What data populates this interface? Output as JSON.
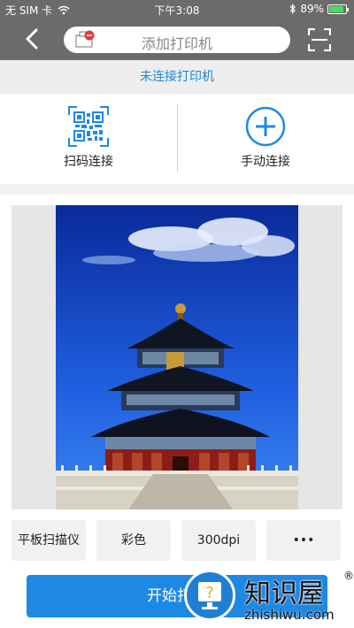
{
  "status_bar": {
    "carrier": "无 SIM 卡",
    "time": "下午3:08",
    "battery": "89%"
  },
  "nav": {
    "title": "添加打印机"
  },
  "banner": {
    "text": "未连接打印机"
  },
  "connect": {
    "scan_label": "扫码连接",
    "manual_label": "手动连接"
  },
  "options": [
    {
      "label": "平板扫描仪"
    },
    {
      "label": "彩色"
    },
    {
      "label": "300dpi"
    },
    {
      "label": "•••"
    }
  ],
  "start_button": {
    "label": "开始打印"
  },
  "watermark": {
    "brand": "知识屋",
    "url": "zhishiwu.com",
    "reg": "®"
  },
  "icons": {
    "back": "back-chevron-icon",
    "printer": "printer-icon",
    "scan": "scan-frame-icon",
    "qr": "qr-code-icon",
    "add": "plus-circle-icon",
    "wifi": "wifi-icon",
    "bluetooth": "bluetooth-icon",
    "battery": "battery-icon"
  },
  "colors": {
    "accent": "#1e88e5",
    "header": "#6b6b6b",
    "banner_text": "#1e88d6"
  }
}
